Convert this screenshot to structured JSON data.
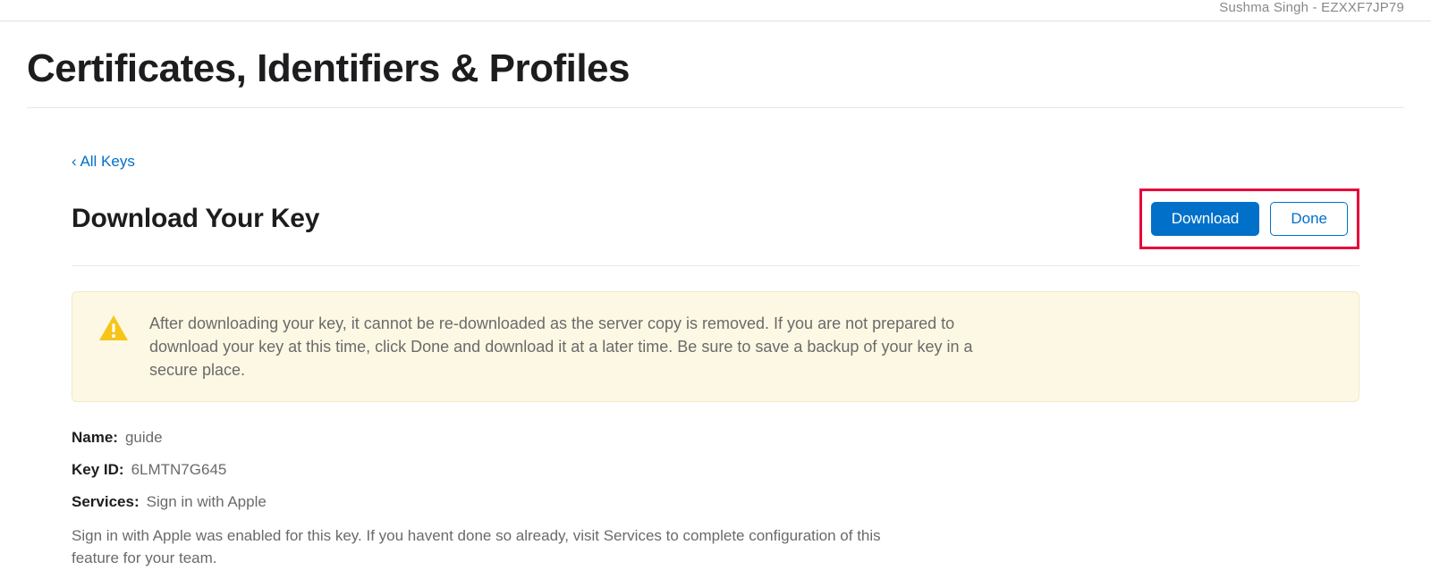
{
  "topbar": {
    "user_label": "Sushma Singh - EZXXF7JP79"
  },
  "page_title": "Certificates, Identifiers & Profiles",
  "back_link": "‹ All Keys",
  "sub_title": "Download Your Key",
  "buttons": {
    "download": "Download",
    "done": "Done"
  },
  "warning": {
    "text": "After downloading your key, it cannot be re-downloaded as the server copy is removed. If you are not prepared to download your key at this time, click Done and download it at a later time. Be sure to save a backup of your key in a secure place."
  },
  "details": {
    "name_label": "Name:",
    "name_value": "guide",
    "keyid_label": "Key ID:",
    "keyid_value": "6LMTN7G645",
    "services_label": "Services:",
    "services_value": "Sign in with Apple",
    "note": "Sign in with Apple was enabled for this key. If you havent done so already, visit Services to complete configuration of this feature for your team."
  }
}
